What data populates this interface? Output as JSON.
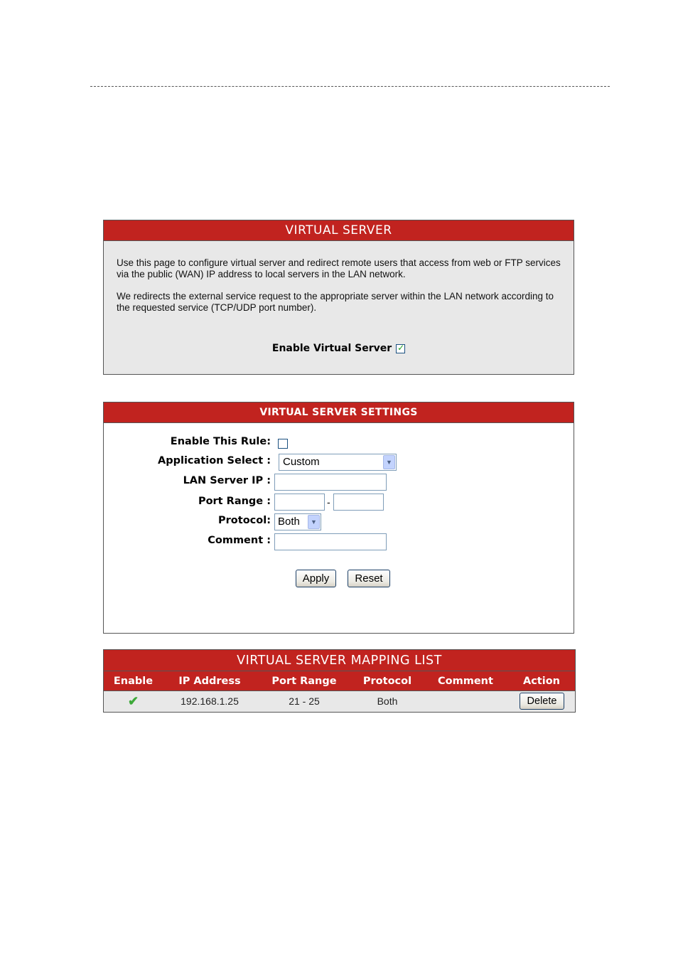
{
  "virtual_server": {
    "title": "VIRTUAL SERVER",
    "description_1": "Use this page to configure virtual server and redirect remote users that access from web or FTP services via the public (WAN) IP address to local servers in the LAN network.",
    "description_2": "We redirects the external service request to the appropriate server within the LAN network according to the requested service (TCP/UDP port number).",
    "enable_label": "Enable Virtual Server",
    "enable_checked": true
  },
  "settings": {
    "title": "VIRTUAL SERVER SETTINGS",
    "enable_rule_label": "Enable This Rule:",
    "enable_rule_checked": false,
    "app_select_label": "Application Select :",
    "app_select_value": "Custom",
    "lan_ip_label": "LAN Server IP :",
    "lan_ip_value": "",
    "port_range_label": "Port Range :",
    "port_start_value": "",
    "port_separator": "-",
    "port_end_value": "",
    "protocol_label": "Protocol:",
    "protocol_value": "Both",
    "comment_label": "Comment :",
    "comment_value": "",
    "apply_label": "Apply",
    "reset_label": "Reset"
  },
  "mapping_list": {
    "title": "VIRTUAL SERVER MAPPING LIST",
    "columns": [
      "Enable",
      "IP Address",
      "Port Range",
      "Protocol",
      "Comment",
      "Action"
    ],
    "rows": [
      {
        "enabled_icon": "check-icon",
        "ip": "192.168.1.25",
        "port_range": "21 - 25",
        "protocol": "Both",
        "comment": "",
        "action": "Delete"
      }
    ]
  },
  "colors": {
    "header_red": "#c1231f",
    "panel_gray": "#e8e8e8"
  }
}
